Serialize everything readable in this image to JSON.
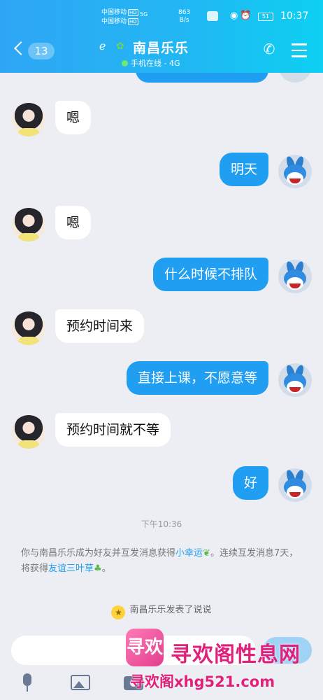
{
  "status_bar": {
    "carrier_1": "中国移动",
    "carrier_2": "中国移动",
    "hd_badge": "HD",
    "signal": "5G",
    "net_speed_value": "863",
    "net_speed_unit": "B/s",
    "battery": "51",
    "time": "10:37",
    "icons": [
      "eye-icon",
      "alarm-icon"
    ]
  },
  "header": {
    "unread_count": "13",
    "contact_name": "南昌乐乐",
    "online_status": "手机在线 - 4G",
    "icons": [
      "back-chevron-icon",
      "ear-icon",
      "clover-icon",
      "phone-icon",
      "menu-icon"
    ]
  },
  "messages": [
    {
      "side": "left",
      "text": "嗯"
    },
    {
      "side": "right",
      "text": "明天"
    },
    {
      "side": "left",
      "text": "嗯"
    },
    {
      "side": "right",
      "text": "什么时候不排队"
    },
    {
      "side": "left",
      "text": "预约时间来"
    },
    {
      "side": "right",
      "text": "直接上课，不愿意等"
    },
    {
      "side": "left",
      "text": "预约时间就不等"
    },
    {
      "side": "right",
      "text": "好"
    }
  ],
  "timestamp": "下午10:36",
  "system_note": {
    "part1": "你与南昌乐乐成为好友并互发消息获得",
    "link1": "小幸运",
    "part2": "。连续互发消息7天，将获得",
    "link2": "友谊三叶草",
    "part3": "。"
  },
  "feed_note": "南昌乐乐发表了说说",
  "input": {
    "placeholder": "",
    "send_label": ""
  },
  "watermark": {
    "logo_text": "寻欢",
    "title": "寻欢阁性息网",
    "url": "寻欢阁xhg521.com"
  },
  "colors": {
    "accent": "#1f9ef2",
    "header_start": "#2fa6f5",
    "header_end": "#0dd0f2",
    "watermark": "#e0207a"
  }
}
